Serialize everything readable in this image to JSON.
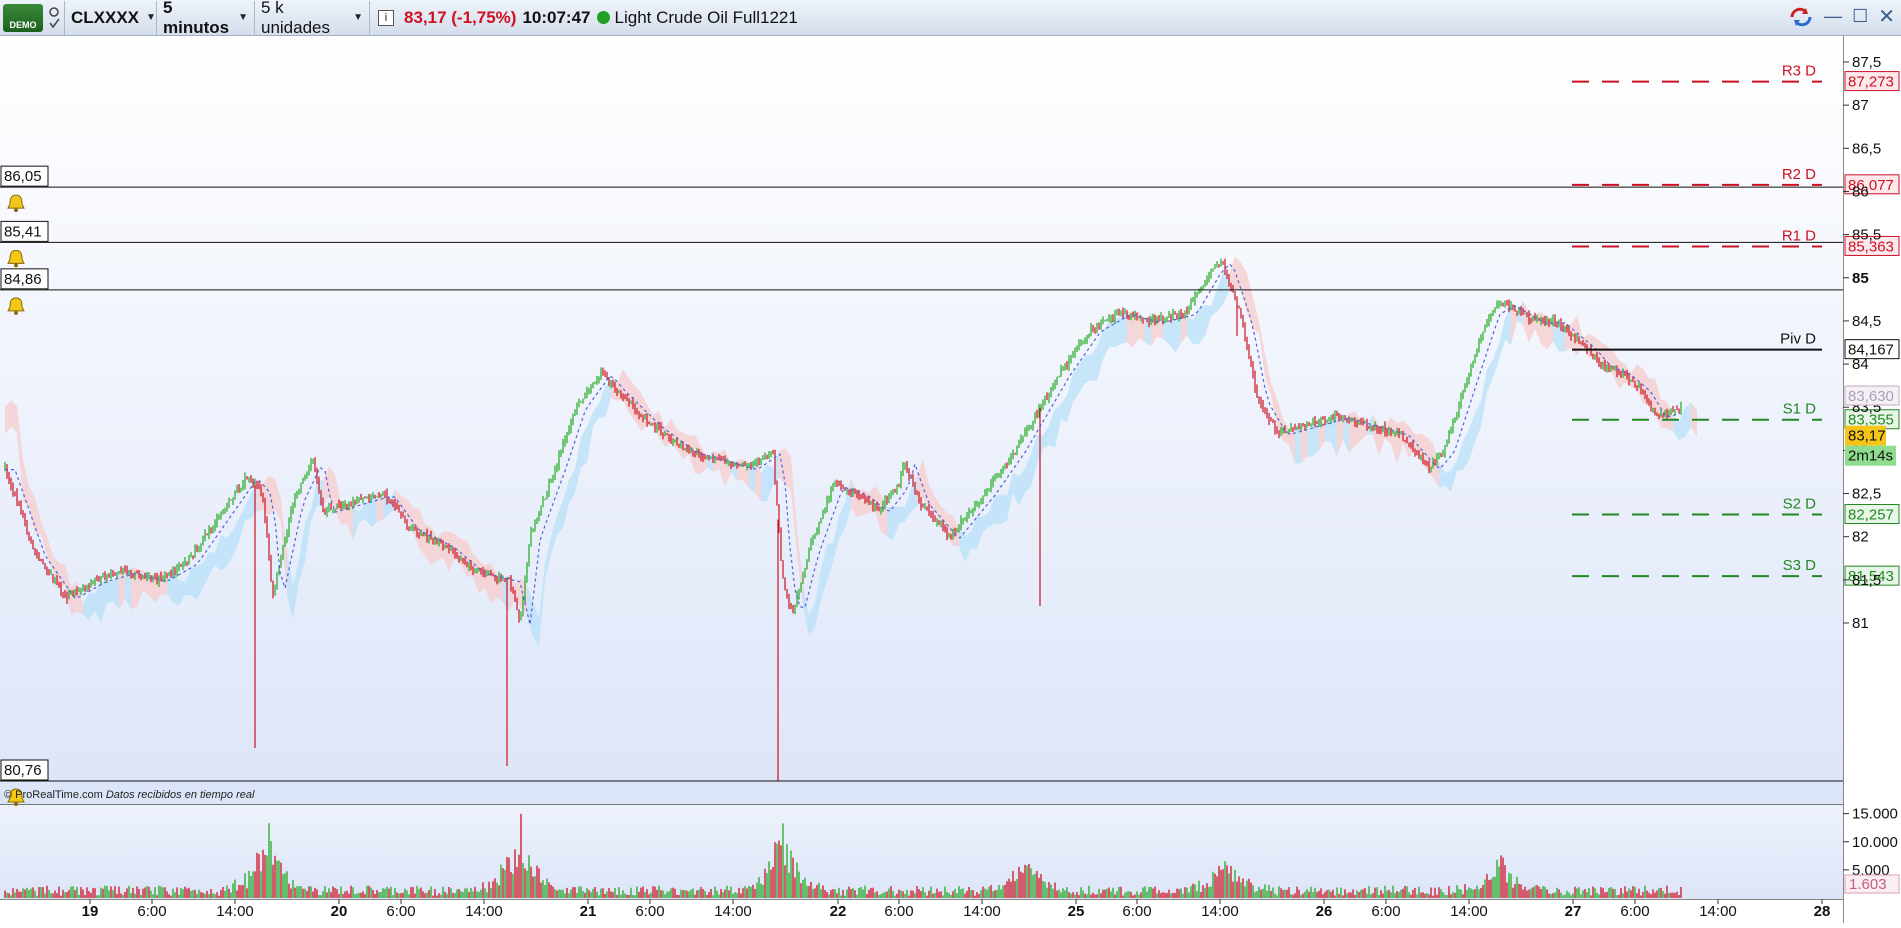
{
  "toolbar": {
    "demo_badge": "DEMO",
    "symbol": "CLXXXX",
    "timeframe": "5 minutos",
    "units": "5 k unidades",
    "price_change": "83,17 (-1,75%)",
    "time": "10:07:47",
    "instrument": "Light Crude Oil Full1221"
  },
  "colors": {
    "up": "#22aa22",
    "down": "#cc1122",
    "resistance": "#cc1122",
    "support": "#228822",
    "background_top": "#ffffff",
    "background_bottom": "#dde6f8"
  },
  "price_axis": [
    "87,5",
    "87",
    "86,5",
    "86",
    "85,5",
    "85",
    "84,5",
    "84",
    "83,5",
    "83",
    "82,5",
    "82",
    "81,5",
    "81"
  ],
  "volume_axis": [
    "15.000",
    "10.000",
    "5.000"
  ],
  "volume_label": "1.603",
  "time_axis": [
    {
      "label": "19",
      "major": true
    },
    {
      "label": "6:00"
    },
    {
      "label": "14:00"
    },
    {
      "label": "20",
      "major": true
    },
    {
      "label": "6:00"
    },
    {
      "label": "14:00"
    },
    {
      "label": "21",
      "major": true
    },
    {
      "label": "6:00"
    },
    {
      "label": "14:00"
    },
    {
      "label": "22",
      "major": true
    },
    {
      "label": "6:00"
    },
    {
      "label": "14:00"
    },
    {
      "label": "25",
      "major": true
    },
    {
      "label": "6:00"
    },
    {
      "label": "14:00"
    },
    {
      "label": "26",
      "major": true
    },
    {
      "label": "6:00"
    },
    {
      "label": "14:00"
    },
    {
      "label": "27",
      "major": true
    },
    {
      "label": "6:00"
    },
    {
      "label": "14:00"
    },
    {
      "label": "28",
      "major": true
    }
  ],
  "alerts": [
    "86,05",
    "85,41",
    "84,86",
    "80,76"
  ],
  "pivots": [
    {
      "name": "R3 D",
      "value": "87,273",
      "kind": "r"
    },
    {
      "name": "R2 D",
      "value": "86,077",
      "kind": "r"
    },
    {
      "name": "R1 D",
      "value": "85,363",
      "kind": "r"
    },
    {
      "name": "Piv D",
      "value": "84,167",
      "kind": "p"
    },
    {
      "name": "S1 D",
      "value": "83,355",
      "kind": "s"
    },
    {
      "name": "S2 D",
      "value": "82,257",
      "kind": "s"
    },
    {
      "name": "S3 D",
      "value": "81,543",
      "kind": "s"
    }
  ],
  "axis_badges": {
    "cloud": "83,630",
    "last_price": "83,17",
    "countdown": "2m14s"
  },
  "footer": {
    "brand": "© ProRealTime.com",
    "note": "Datos recibidos en tiempo real"
  },
  "chart_data": {
    "type": "candlestick",
    "y_range": [
      80.6,
      87.8
    ],
    "close_path": [
      [
        0,
        82.8
      ],
      [
        0.3,
        81.8
      ],
      [
        0.6,
        81.3
      ],
      [
        0.9,
        81.5
      ],
      [
        1.2,
        81.6
      ],
      [
        1.5,
        81.5
      ],
      [
        1.8,
        81.7
      ],
      [
        2.1,
        82.2
      ],
      [
        2.4,
        82.7
      ],
      [
        2.55,
        82.5
      ],
      [
        2.65,
        81.3
      ],
      [
        2.85,
        82.4
      ],
      [
        3.05,
        82.9
      ],
      [
        3.15,
        82.3
      ],
      [
        3.45,
        82.4
      ],
      [
        3.75,
        82.5
      ],
      [
        4.0,
        82.1
      ],
      [
        4.35,
        81.9
      ],
      [
        4.65,
        81.6
      ],
      [
        5.0,
        81.5
      ],
      [
        5.1,
        81.0
      ],
      [
        5.2,
        82.0
      ],
      [
        5.45,
        82.8
      ],
      [
        5.65,
        83.5
      ],
      [
        5.9,
        83.9
      ],
      [
        6.05,
        83.7
      ],
      [
        6.4,
        83.3
      ],
      [
        6.75,
        83.0
      ],
      [
        7.05,
        82.9
      ],
      [
        7.35,
        82.8
      ],
      [
        7.6,
        83.0
      ],
      [
        7.7,
        81.5
      ],
      [
        7.8,
        81.1
      ],
      [
        7.95,
        81.8
      ],
      [
        8.2,
        82.6
      ],
      [
        8.45,
        82.5
      ],
      [
        8.65,
        82.3
      ],
      [
        8.85,
        82.6
      ],
      [
        8.9,
        82.9
      ],
      [
        9.05,
        82.4
      ],
      [
        9.35,
        82.0
      ],
      [
        9.7,
        82.5
      ],
      [
        10.0,
        83.0
      ],
      [
        10.15,
        83.3
      ],
      [
        10.45,
        83.9
      ],
      [
        10.75,
        84.4
      ],
      [
        11.05,
        84.6
      ],
      [
        11.35,
        84.5
      ],
      [
        11.7,
        84.6
      ],
      [
        11.95,
        85.1
      ],
      [
        12.05,
        85.2
      ],
      [
        12.25,
        84.5
      ],
      [
        12.4,
        83.6
      ],
      [
        12.6,
        83.2
      ],
      [
        12.9,
        83.3
      ],
      [
        13.2,
        83.4
      ],
      [
        13.5,
        83.3
      ],
      [
        13.8,
        83.2
      ],
      [
        14.1,
        82.8
      ],
      [
        14.25,
        83.0
      ],
      [
        14.5,
        83.9
      ],
      [
        14.7,
        84.6
      ],
      [
        14.85,
        84.7
      ],
      [
        15.15,
        84.5
      ],
      [
        15.35,
        84.5
      ],
      [
        15.65,
        84.2
      ],
      [
        15.8,
        84.0
      ],
      [
        16.0,
        83.9
      ],
      [
        16.2,
        83.7
      ],
      [
        16.35,
        83.4
      ],
      [
        16.6,
        83.5
      ]
    ],
    "volume_spikes": [
      [
        2.6,
        13000
      ],
      [
        5.1,
        16000
      ],
      [
        7.7,
        14000
      ],
      [
        10.1,
        8000
      ],
      [
        12.1,
        7500
      ],
      [
        14.8,
        7000
      ]
    ]
  }
}
